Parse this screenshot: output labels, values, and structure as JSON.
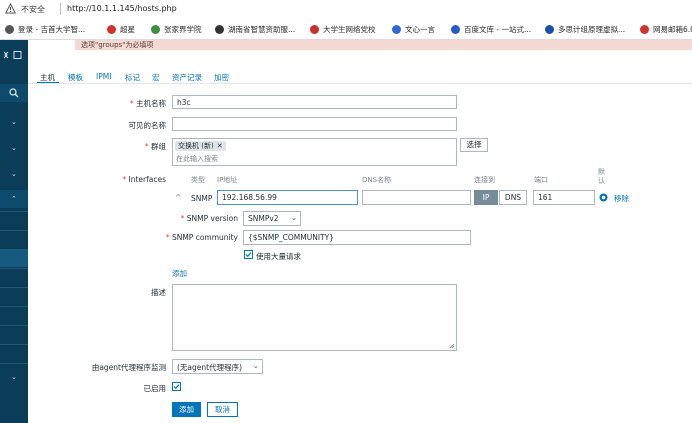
{
  "browser": {
    "insecure_label": "不安全",
    "url": "http://10.1.1.145/hosts.php",
    "bookmarks": [
      {
        "label": "登录 - 吉首大学智...",
        "color": "#555555"
      },
      {
        "label": "超星",
        "color": "#d2322d"
      },
      {
        "label": "张家界学院",
        "color": "#3d8f3d"
      },
      {
        "label": "湖南省智慧资助服...",
        "color": "#333333"
      },
      {
        "label": "大学生网络党校",
        "color": "#c9302c"
      },
      {
        "label": "文心一言",
        "color": "#2f6bd8"
      },
      {
        "label": "百度文库 - 一站式...",
        "color": "#2b59c3"
      },
      {
        "label": "多思计组原理虚拟...",
        "color": "#1c4fa8"
      },
      {
        "label": "网易邮箱6.0",
        "color": "#d2322d"
      }
    ]
  },
  "banner": {
    "text": "选项\"groups\"为必填项"
  },
  "tabs": [
    {
      "label": "主机",
      "active": true
    },
    {
      "label": "模板"
    },
    {
      "label": "IPMI"
    },
    {
      "label": "标记"
    },
    {
      "label": "宏"
    },
    {
      "label": "资产记录"
    },
    {
      "label": "加密"
    }
  ],
  "form": {
    "hostname_label": "主机名称",
    "hostname_value": "h3c",
    "visible_name_label": "可见的名称",
    "visible_name_value": "",
    "groups_label": "群组",
    "group_tag": "交换机 (新)",
    "groups_placeholder": "在此输入搜索",
    "groups_select_button": "选择",
    "interfaces_label": "Interfaces",
    "if_headers": {
      "type": "类型",
      "ip": "IP地址",
      "dns": "DNS名称",
      "connect": "连接到",
      "port": "端口",
      "default": "默认"
    },
    "if_row": {
      "type": "SNMP",
      "ip": "192.168.56.99",
      "dns": "",
      "ip_btn": "IP",
      "dns_btn": "DNS",
      "port": "161",
      "remove": "移除"
    },
    "snmp_version_label": "SNMP version",
    "snmp_version_value": "SNMPv2",
    "snmp_community_label": "SNMP community",
    "snmp_community_value": "{$SNMP_COMMUNITY}",
    "bulk_label": "使用大量请求",
    "add_interface": "添加",
    "description_label": "描述",
    "proxy_label": "由agent代理程序监测",
    "proxy_value": "(无agent代理程序)",
    "enabled_label": "已启用",
    "add_button": "添加",
    "cancel_button": "取消"
  }
}
